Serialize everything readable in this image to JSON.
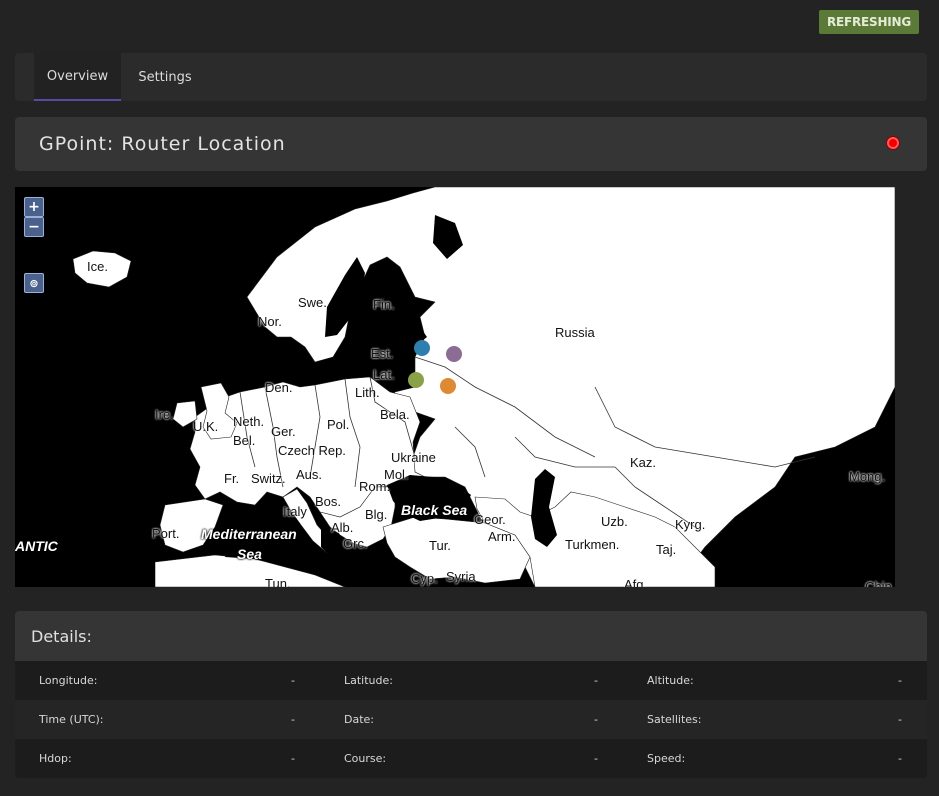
{
  "status": {
    "label": "REFRESHING",
    "color": "#5b7a38"
  },
  "tabs": [
    {
      "label": "Overview",
      "active": true
    },
    {
      "label": "Settings",
      "active": false
    }
  ],
  "title": {
    "text": "GPoint: Router Location",
    "status_color": "#f20000"
  },
  "map": {
    "controls": {
      "zoom_in": "+",
      "zoom_out": "−",
      "locate": "⊚"
    },
    "country_labels": [
      "Ice.",
      "Swe.",
      "Fin.",
      "Nor.",
      "Russia",
      "Est.",
      "Lat.",
      "Lith.",
      "Den.",
      "Ire.",
      "U.K.",
      "Neth.",
      "Bel.",
      "Ger.",
      "Pol.",
      "Bela.",
      "Czech Rep.",
      "Ukraine",
      "Fr.",
      "Switz.",
      "Aus.",
      "Mol.",
      "Rom.",
      "Kaz.",
      "Mong.",
      "Bos.",
      "Italy",
      "Alb.",
      "Blg.",
      "Geor.",
      "Arm.",
      "Port.",
      "Uzb.",
      "Kyrg.",
      "Taj.",
      "Turkmen.",
      "Tur.",
      "Grc.",
      "Cyp.",
      "Syria",
      "Tun.",
      "Afg.",
      "Chin"
    ],
    "sea_labels": [
      "Black Sea",
      "Mediterranean",
      "Sea",
      "ANTIC"
    ],
    "markers": [
      {
        "color": "#2e7fb0"
      },
      {
        "color": "#8c6b95"
      },
      {
        "color": "#8aa14a"
      },
      {
        "color": "#dd8a33"
      }
    ]
  },
  "details": {
    "heading": "Details:",
    "rows": [
      [
        {
          "label": "Longitude:",
          "value": "-"
        },
        {
          "label": "Latitude:",
          "value": "-"
        },
        {
          "label": "Altitude:",
          "value": "-"
        }
      ],
      [
        {
          "label": "Time (UTC):",
          "value": "-"
        },
        {
          "label": "Date:",
          "value": "-"
        },
        {
          "label": "Satellites:",
          "value": "-"
        }
      ],
      [
        {
          "label": "Hdop:",
          "value": "-"
        },
        {
          "label": "Course:",
          "value": "-"
        },
        {
          "label": "Speed:",
          "value": "-"
        }
      ]
    ]
  }
}
